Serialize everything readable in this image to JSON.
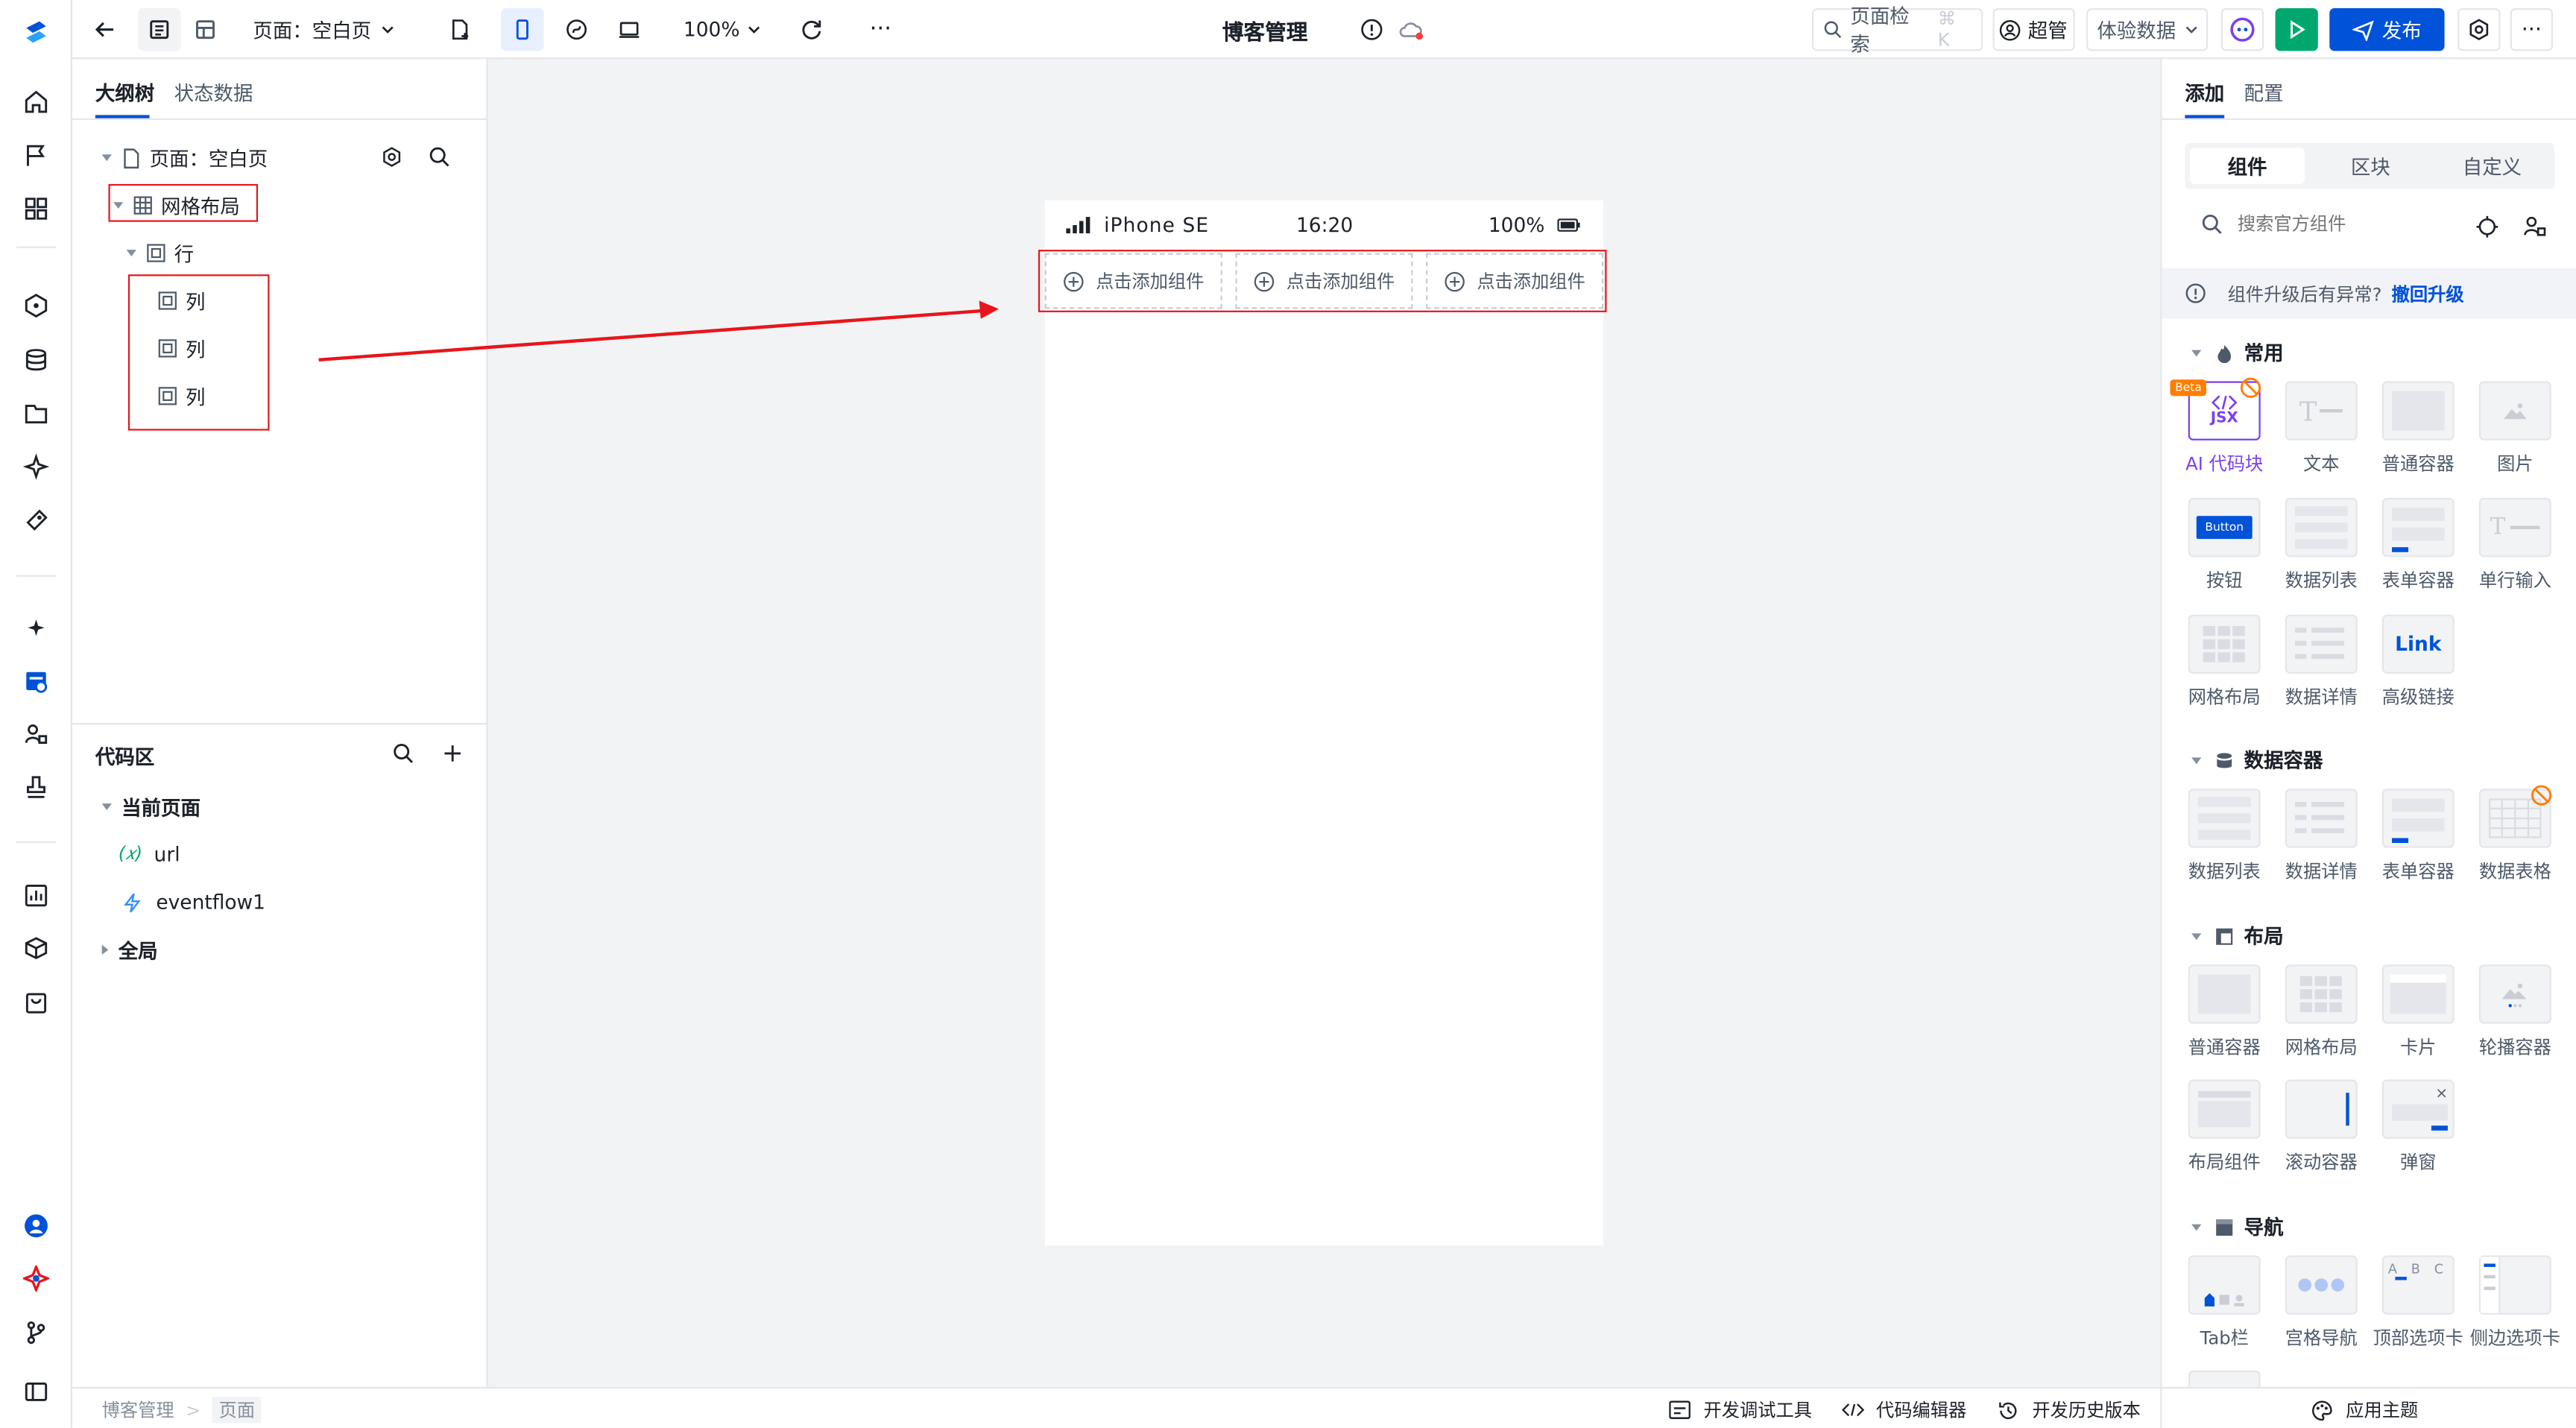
{
  "topbar": {
    "page_select": "页面：空白页",
    "zoom": "100%",
    "app_title": "博客管理",
    "search_label": "页面检索",
    "search_shortcut": "⌘ K",
    "role": "超管",
    "data_select": "体验数据",
    "publish": "发布"
  },
  "left_panel": {
    "tabs": [
      "大纲树",
      "状态数据"
    ],
    "tree": {
      "root": "页面：空白页",
      "grid": "网格布局",
      "row": "行",
      "cols": [
        "列",
        "列",
        "列"
      ]
    },
    "code_area": {
      "title": "代码区",
      "current_page": "当前页面",
      "items": [
        {
          "icon": "(𝑥)",
          "label": "url"
        },
        {
          "icon": "flow-icon",
          "label": "eventflow1"
        }
      ],
      "global": "全局"
    }
  },
  "canvas": {
    "device": "iPhone SE",
    "time": "16:20",
    "battery": "100%",
    "add_component": "点击添加组件"
  },
  "right_panel": {
    "tabs": [
      "添加",
      "配置"
    ],
    "segments": [
      "组件",
      "区块",
      "自定义"
    ],
    "search_placeholder": "搜索官方组件",
    "notice": "组件升级后有异常?",
    "notice_link": "撤回升级",
    "sections": {
      "common": {
        "title": "常用",
        "items": [
          "AI 代码块",
          "文本",
          "普通容器",
          "图片",
          "按钮",
          "数据列表",
          "表单容器",
          "单行输入",
          "网格布局",
          "数据详情",
          "高级链接"
        ]
      },
      "data_container": {
        "title": "数据容器",
        "items": [
          "数据列表",
          "数据详情",
          "表单容器",
          "数据表格"
        ]
      },
      "layout": {
        "title": "布局",
        "items": [
          "普通容器",
          "网格布局",
          "卡片",
          "轮播容器",
          "布局组件",
          "滚动容器",
          "弹窗"
        ]
      },
      "nav": {
        "title": "导航",
        "items": [
          "Tab栏",
          "宫格导航",
          "顶部选项卡",
          "侧边选项卡"
        ]
      }
    },
    "badges": {
      "beta": "Beta",
      "jsx": "JSX",
      "button": "Button",
      "link": "Link",
      "abc": "A B C"
    }
  },
  "bottombar": {
    "breadcrumb": [
      "博客管理",
      "页面"
    ],
    "tools": [
      "开发调试工具",
      "代码编辑器",
      "开发历史版本"
    ],
    "theme": "应用主题"
  },
  "colors": {
    "primary": "#0052d9",
    "highlight": "#e8151b",
    "run": "#00a870",
    "ai": "#7b3ff2"
  }
}
